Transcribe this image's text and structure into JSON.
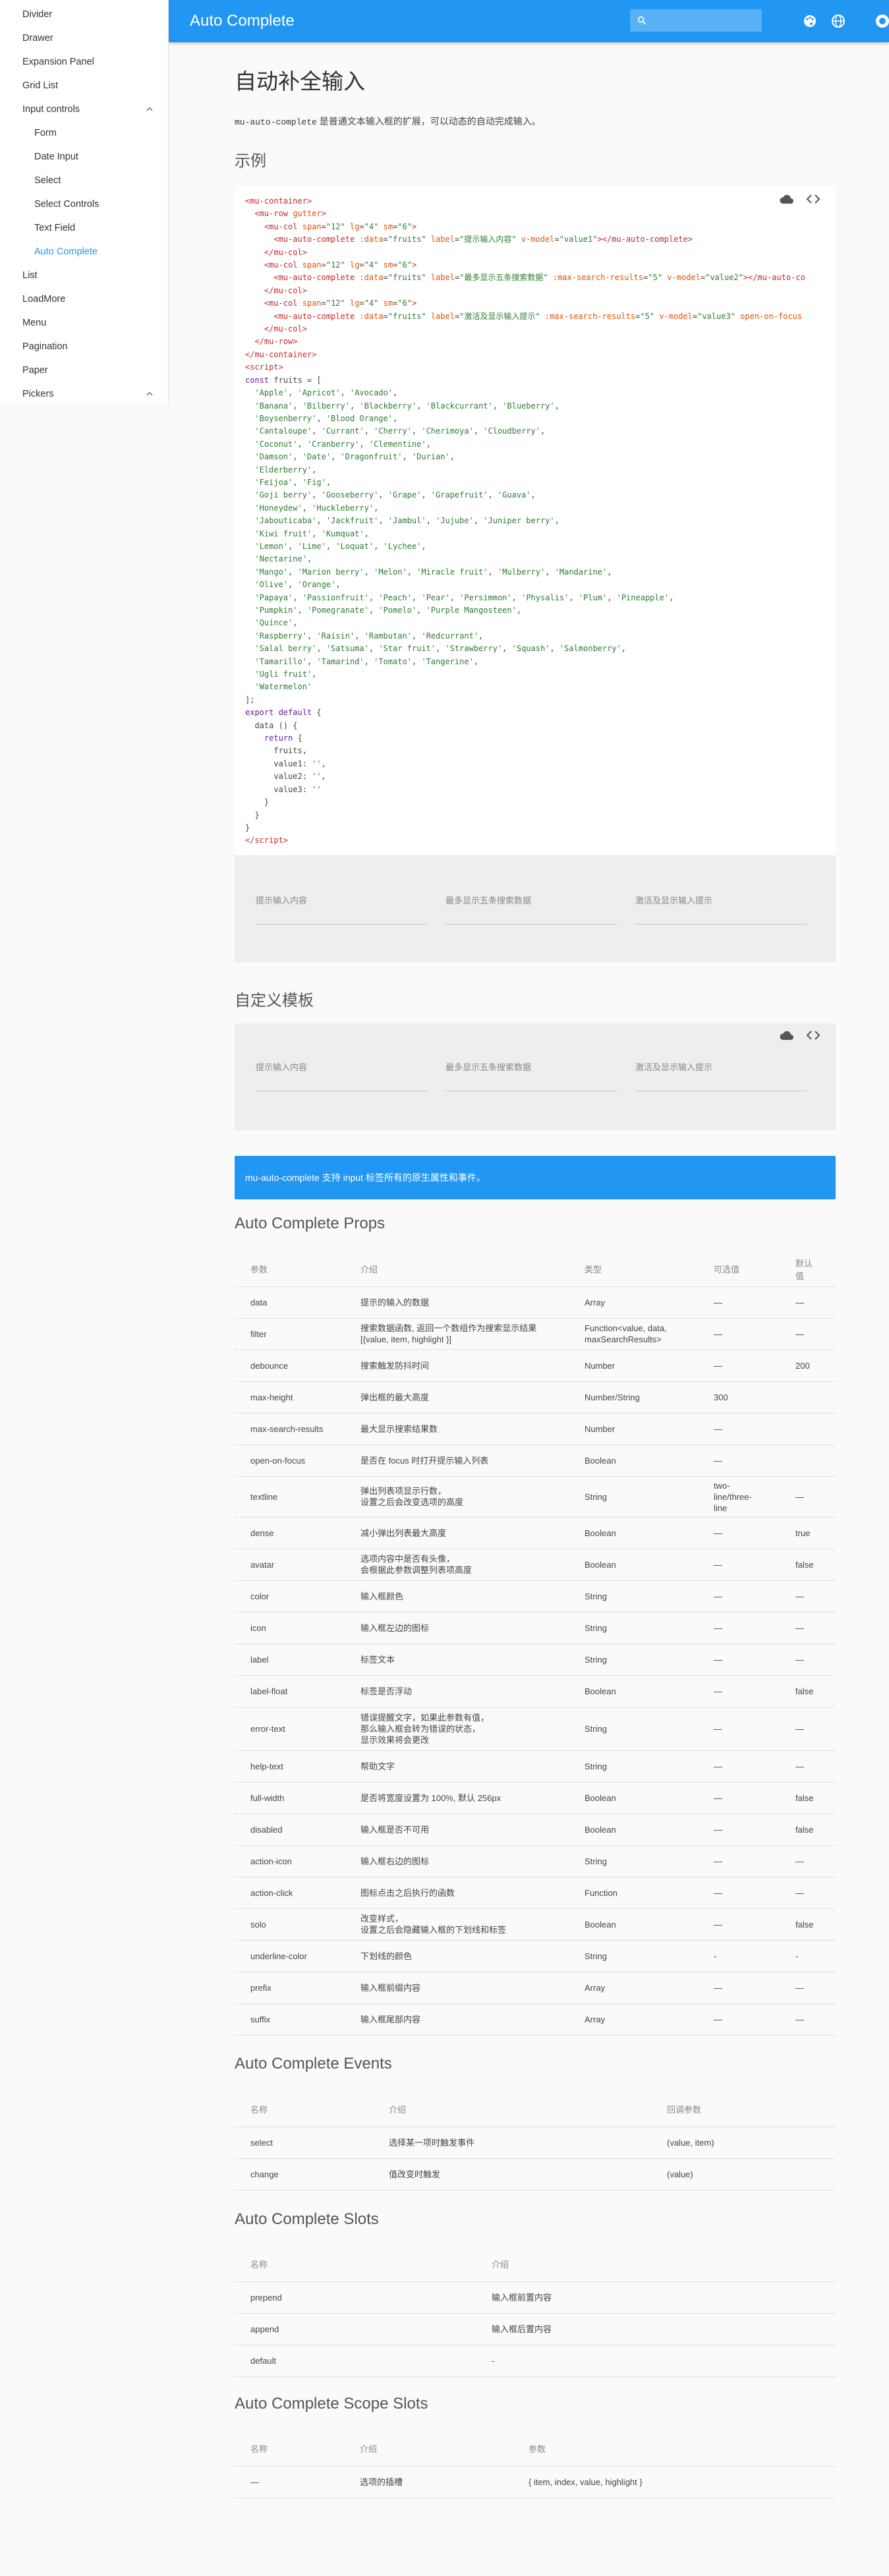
{
  "appbar": {
    "title": "Auto Complete"
  },
  "sidebar": {
    "items": [
      {
        "label": "Divider"
      },
      {
        "label": "Drawer"
      },
      {
        "label": "Expansion Panel"
      },
      {
        "label": "Grid List"
      },
      {
        "label": "Input controls"
      },
      {
        "label": "Form"
      },
      {
        "label": "Date Input"
      },
      {
        "label": "Select"
      },
      {
        "label": "Select Controls"
      },
      {
        "label": "Text Field"
      },
      {
        "label": "Auto Complete"
      },
      {
        "label": "List"
      },
      {
        "label": "LoadMore"
      },
      {
        "label": "Menu"
      },
      {
        "label": "Pagination"
      },
      {
        "label": "Paper"
      },
      {
        "label": "Pickers"
      }
    ]
  },
  "page": {
    "title": "自动补全输入",
    "intro_code": "mu-auto-complete",
    "intro_text": " 是普通文本输入框的扩展，可以动态的自动完成输入。",
    "example_title": "示例",
    "custom_title": "自定义模板",
    "alert": "mu-auto-complete 支持 input 标签所有的原生属性和事件。"
  },
  "demo1": {
    "labels": [
      "提示输入内容",
      "最多显示五条搜索数据",
      "激活及显示输入提示"
    ]
  },
  "demo2": {
    "labels": [
      "提示输入内容",
      "最多显示五条搜索数据",
      "激活及显示输入提示"
    ]
  },
  "props": {
    "title": "Auto Complete Props",
    "headers": [
      "参数",
      "介绍",
      "类型",
      "可选值",
      "默认值"
    ],
    "rows": [
      [
        "data",
        "提示的输入的数据",
        "Array",
        "—",
        "—"
      ],
      [
        "filter",
        "搜索数据函数, 返回一个数组作为搜索显示结果 [{value, item, highlight }]",
        "Function<value, data, maxSearchResults>",
        "—",
        "—"
      ],
      [
        "debounce",
        "搜索触发防抖时间",
        "Number",
        "—",
        "200"
      ],
      [
        "max-height",
        "弹出框的最大高度",
        "Number/String",
        "300",
        ""
      ],
      [
        "max-search-results",
        "最大显示搜索结果数",
        "Number",
        "—",
        ""
      ],
      [
        "open-on-focus",
        "是否在 focus 时打开提示输入列表",
        "Boolean",
        "—",
        ""
      ],
      [
        "textline",
        "弹出列表项显示行数，\n设置之后会改变选项的高度",
        "String",
        "two-line/three-line",
        "—"
      ],
      [
        "dense",
        "减小弹出列表最大高度",
        "Boolean",
        "—",
        "true"
      ],
      [
        "avatar",
        "选项内容中是否有头像，\n会根据此参数调整列表项高度",
        "Boolean",
        "—",
        "false"
      ],
      [
        "color",
        "输入框颜色",
        "String",
        "—",
        "—"
      ],
      [
        "icon",
        "输入框左边的图标",
        "String",
        "—",
        "—"
      ],
      [
        "label",
        "标签文本",
        "String",
        "—",
        "—"
      ],
      [
        "label-float",
        "标签是否浮动",
        "Boolean",
        "—",
        "false"
      ],
      [
        "error-text",
        "错误提醒文字，如果此参数有值，\n那么输入框会转为错误的状态，\n显示效果将会更改",
        "String",
        "—",
        "—"
      ],
      [
        "help-text",
        "帮助文字",
        "String",
        "—",
        "—"
      ],
      [
        "full-width",
        "是否将宽度设置为 100%, 默认 256px",
        "Boolean",
        "—",
        "false"
      ],
      [
        "disabled",
        "输入框是否不可用",
        "Boolean",
        "—",
        "false"
      ],
      [
        "action-icon",
        "输入框右边的图标",
        "String",
        "—",
        "—"
      ],
      [
        "action-click",
        "图标点击之后执行的函数",
        "Function",
        "—",
        "—"
      ],
      [
        "solo",
        "改变样式，\n设置之后会隐藏输入框的下划线和标签",
        "Boolean",
        "—",
        "false"
      ],
      [
        "underline-color",
        "下划线的颜色",
        "String",
        "-",
        "-"
      ],
      [
        "prefix",
        "输入框前缀内容",
        "Array",
        "—",
        "—"
      ],
      [
        "suffix",
        "输入框尾部内容",
        "Array",
        "—",
        "—"
      ]
    ]
  },
  "events": {
    "title": "Auto Complete Events",
    "headers": [
      "名称",
      "介绍",
      "回调参数"
    ],
    "rows": [
      [
        "select",
        "选择某一项时触发事件",
        "(value, item)"
      ],
      [
        "change",
        "值改变时触发",
        "(value)"
      ]
    ]
  },
  "slots": {
    "title": "Auto Complete Slots",
    "headers": [
      "名称",
      "介绍"
    ],
    "rows": [
      [
        "prepend",
        "输入框前置内容"
      ],
      [
        "append",
        "输入框后置内容"
      ],
      [
        "default",
        "-"
      ]
    ]
  },
  "scope": {
    "title": "Auto Complete Scope Slots",
    "headers": [
      "名称",
      "介绍",
      "参数"
    ],
    "rows": [
      [
        "—",
        "选项的插槽",
        "{ item, index, value, highlight }"
      ]
    ]
  },
  "colors": {
    "primary": "#2196f3"
  }
}
